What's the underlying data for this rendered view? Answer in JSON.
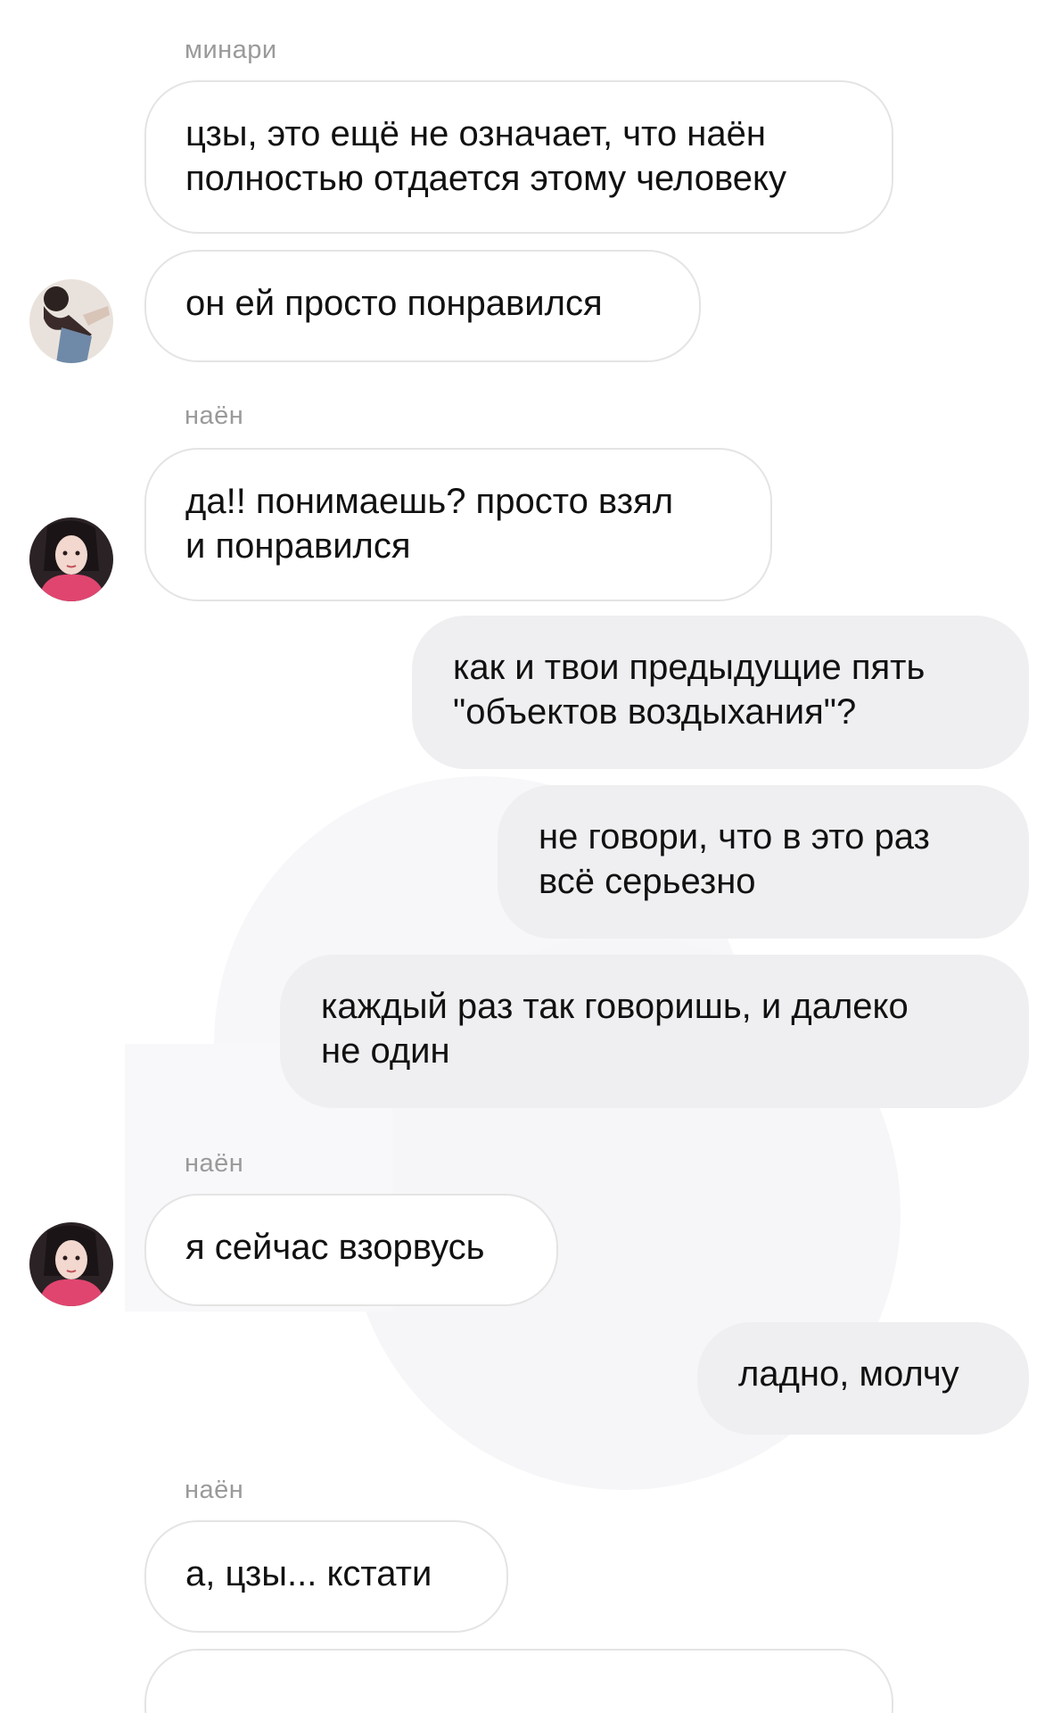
{
  "conversation": {
    "groups": [
      {
        "sender": "минари",
        "avatar_icon": "minari-avatar"
      },
      {
        "sender": "наён",
        "avatar_icon": "nayeon-avatar"
      },
      {
        "sender": "наён",
        "avatar_icon": "nayeon-avatar"
      },
      {
        "sender": "наён",
        "avatar_icon": "nayeon-avatar"
      }
    ],
    "messages": [
      {
        "text": "цзы, это ещё не означает, что наён\nполностью отдается этому человеку",
        "direction": "incoming"
      },
      {
        "text": "он ей просто понравился",
        "direction": "incoming"
      },
      {
        "text": "да!! понимаешь? просто взял\nи понравился",
        "direction": "incoming"
      },
      {
        "text": "как и твои предыдущие пять\n\"объектов воздыхания\"?",
        "direction": "outgoing"
      },
      {
        "text": "не говори, что в это раз\nвсё серьезно",
        "direction": "outgoing"
      },
      {
        "text": "каждый раз так говоришь, и далеко\nне один",
        "direction": "outgoing"
      },
      {
        "text": "я сейчас взорвусь",
        "direction": "incoming"
      },
      {
        "text": "ладно, молчу",
        "direction": "outgoing"
      },
      {
        "text": "а, цзы... кстати",
        "direction": "incoming"
      },
      {
        "text": "",
        "direction": "incoming"
      }
    ]
  },
  "colors": {
    "incoming_bubble": "#ffffff",
    "incoming_border": "#e4e4e4",
    "outgoing_bubble": "#efeff1",
    "sender_label": "#9a9a9a",
    "text": "#111111"
  }
}
